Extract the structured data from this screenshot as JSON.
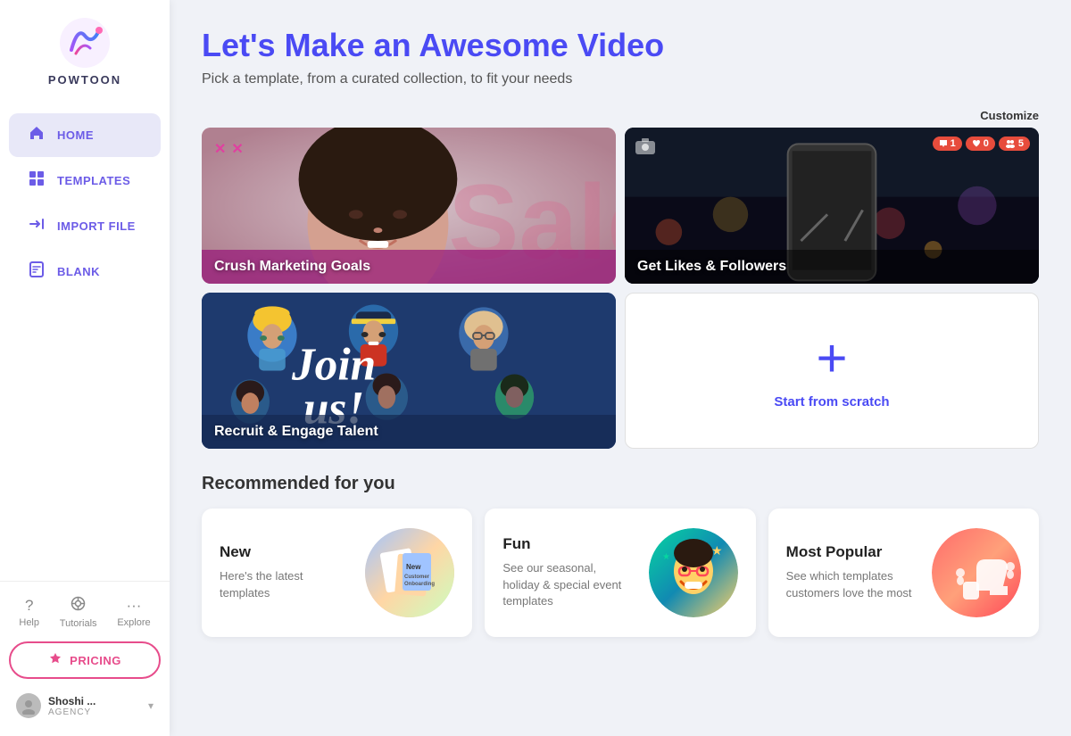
{
  "sidebar": {
    "logo_text": "POWTOON",
    "nav_items": [
      {
        "id": "home",
        "label": "HOME",
        "active": true,
        "icon": "🏠"
      },
      {
        "id": "templates",
        "label": "TEMPLATES",
        "active": false,
        "icon": "▦"
      },
      {
        "id": "import-file",
        "label": "IMPORT FILE",
        "active": false,
        "icon": "➡"
      },
      {
        "id": "blank",
        "label": "BLANK",
        "active": false,
        "icon": "📄"
      }
    ],
    "help_items": [
      {
        "id": "help",
        "label": "Help",
        "icon": "?"
      },
      {
        "id": "tutorials",
        "label": "Tutorials",
        "icon": "👁"
      },
      {
        "id": "explore",
        "label": "Explore",
        "icon": "···"
      }
    ],
    "pricing_label": "PRICING",
    "user": {
      "name": "Shoshi ...",
      "role": "AGENCY"
    }
  },
  "main": {
    "title": "Let's Make an Awesome Video",
    "subtitle": "Pick a template, from a curated collection, to fit your needs",
    "customize_label": "Customize",
    "templates": [
      {
        "id": "crush-marketing",
        "title": "Crush Marketing Goals",
        "type": "crush"
      },
      {
        "id": "get-likes",
        "title": "Get Likes & Followers",
        "type": "likes",
        "badges": [
          "1",
          "0",
          "5"
        ]
      },
      {
        "id": "recruit-talent",
        "title": "Recruit & Engage Talent",
        "type": "recruit"
      },
      {
        "id": "scratch",
        "title": "Start from scratch",
        "type": "scratch",
        "plus": "+"
      }
    ],
    "recommended_title": "Recommended for you",
    "rec_cards": [
      {
        "id": "new",
        "title": "New",
        "desc": "Here's the latest templates",
        "img_label": "New Customer\nOnboarding"
      },
      {
        "id": "fun",
        "title": "Fun",
        "desc": "See our seasonal, holiday & special event templates"
      },
      {
        "id": "most-popular",
        "title": "Most Popular",
        "desc": "See which templates customers love the most"
      }
    ]
  }
}
